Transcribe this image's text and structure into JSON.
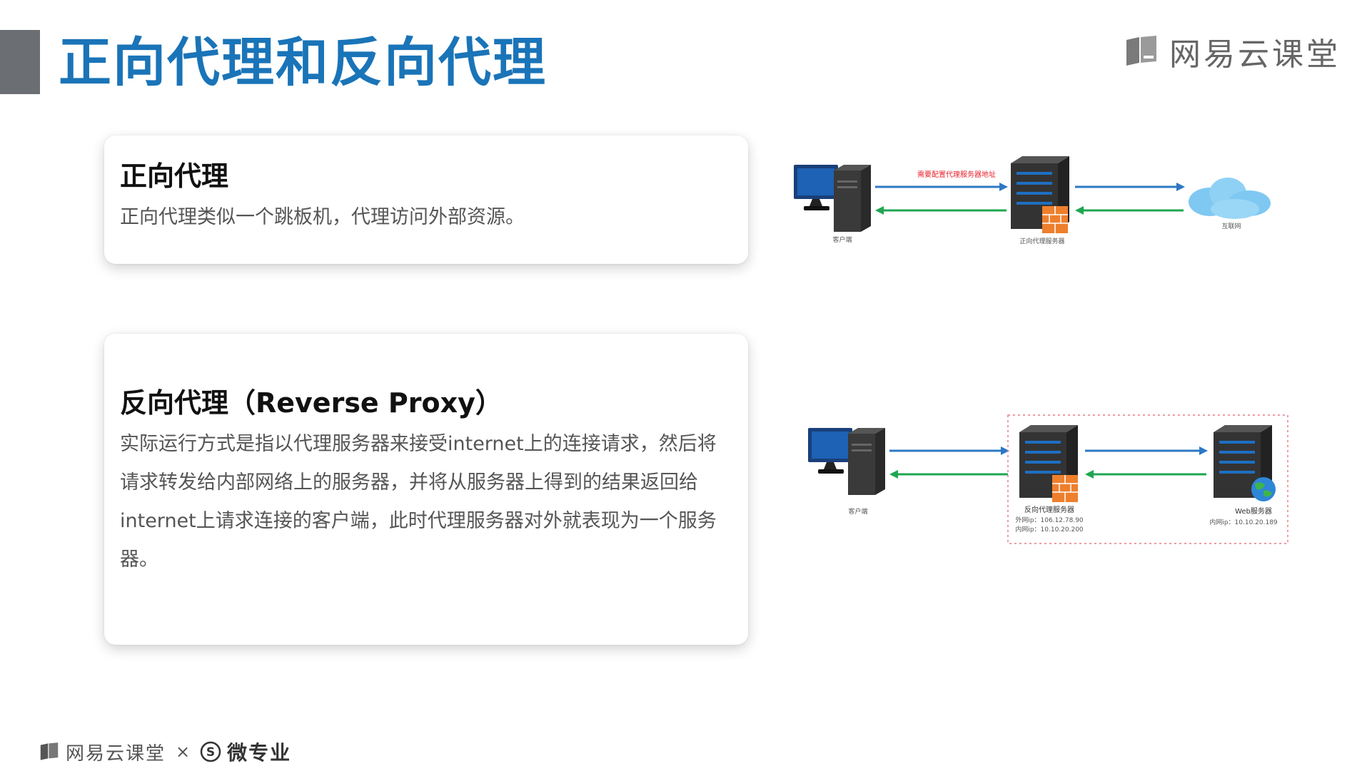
{
  "page": {
    "title": "正向代理和反向代理"
  },
  "brand": {
    "name": "网易云课堂",
    "icon": "book-icon"
  },
  "cards": {
    "forward": {
      "title": "正向代理",
      "body": "正向代理类似一个跳板机，代理访问外部资源。"
    },
    "reverse": {
      "title": "反向代理（Reverse Proxy）",
      "body": "实际运行方式是指以代理服务器来接受internet上的连接请求，然后将请求转发给内部网络上的服务器，并将从服务器上得到的结果返回给internet上请求连接的客户端，此时代理服务器对外就表现为一个服务器。"
    }
  },
  "diagram_forward": {
    "client_label": "客户端",
    "proxy_label": "正向代理服务器",
    "internet_label": "互联网",
    "arrow_note": "需要配置代理服务器地址"
  },
  "diagram_reverse": {
    "client_label": "客户端",
    "proxy_label": "反向代理服务器",
    "proxy_outer_ip": "外网ip：106.12.78.90",
    "proxy_inner_ip": "内网ip：10.10.20.200",
    "web_label": "Web服务器",
    "web_inner_ip": "内网ip：10.10.20.189"
  },
  "footer": {
    "brand": "网易云课堂",
    "separator": "×",
    "partner": "微专业",
    "partner_icon": "s-circle-icon"
  },
  "colors": {
    "title": "#1a74b8",
    "arrow_request": "#2c78c5",
    "arrow_response": "#1fa651",
    "note_red": "#e8202a",
    "firewall": "#ee7f2d",
    "cloud": "#7ec8f2",
    "dashed_box": "#e87a86",
    "title_bar": "#6b6e72"
  }
}
